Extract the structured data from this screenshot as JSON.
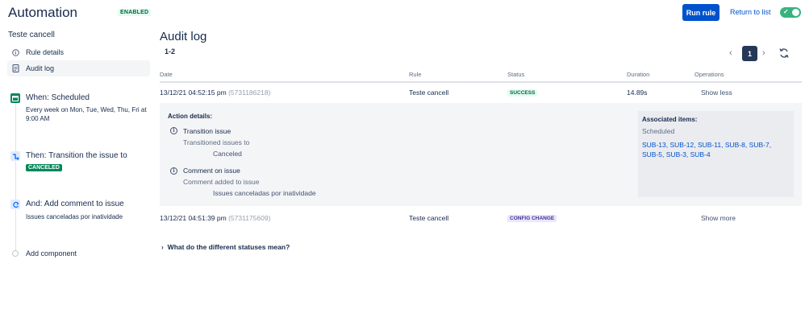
{
  "header": {
    "title": "Automation",
    "enabled_label": "ENABLED",
    "run_rule_label": "Run rule",
    "return_label": "Return to list",
    "toggle_on": true
  },
  "sidebar": {
    "rule_name": "Teste cancell",
    "items": [
      {
        "label": "Rule details",
        "icon": "info-icon",
        "active": false
      },
      {
        "label": "Audit log",
        "icon": "document-icon",
        "active": true
      }
    ],
    "components": [
      {
        "title": "When: Scheduled",
        "description": "Every week on Mon, Tue, Wed, Thu, Fri at 9:00 AM",
        "icon": "calendar-icon",
        "color": "#00875a"
      },
      {
        "title": "Then: Transition the issue to",
        "lozenge": "CANCELED",
        "icon": "transition-icon",
        "color": "#0065ff"
      },
      {
        "title": "And: Add comment to issue",
        "description": "Issues canceladas por inatividade",
        "icon": "comment-action-icon",
        "color": "#0065ff"
      }
    ],
    "add_component_label": "Add component"
  },
  "main": {
    "title": "Audit log",
    "range": "1-2",
    "pagination": {
      "current_page": "1"
    },
    "columns": [
      "Date",
      "Rule",
      "Status",
      "Duration",
      "Operations"
    ],
    "rows": [
      {
        "date": "13/12/21 04:52:15 pm",
        "id": "(5731186218)",
        "rule": "Teste cancell",
        "status": "SUCCESS",
        "duration": "14.89s",
        "operation": "Show less"
      },
      {
        "date": "13/12/21 04:51:39 pm",
        "id": "(5731175609)",
        "rule": "Teste cancell",
        "status": "CONFIG CHANGE",
        "duration": "",
        "operation": "Show more"
      }
    ],
    "details": {
      "label": "Action details:",
      "actions": [
        {
          "title": "Transition issue",
          "subtitle": "Transitioned issues to",
          "value": "Canceled"
        },
        {
          "title": "Comment on issue",
          "subtitle": "Comment added to issue",
          "value": "Issues canceladas por inatividade"
        }
      ],
      "associated": {
        "label": "Associated items:",
        "trigger": "Scheduled",
        "items": [
          "SUB-13",
          "SUB-12",
          "SUB-11",
          "SUB-8",
          "SUB-7",
          "SUB-5",
          "SUB-3",
          "SUB-4"
        ]
      }
    },
    "faq_label": "What do the different statuses mean?"
  },
  "colors": {
    "primary": "#0052cc",
    "success_text": "#006644",
    "success_bg": "#e3fcef",
    "config_text": "#403294",
    "config_bg": "#eae6ff",
    "toggle_on": "#36b37e"
  }
}
